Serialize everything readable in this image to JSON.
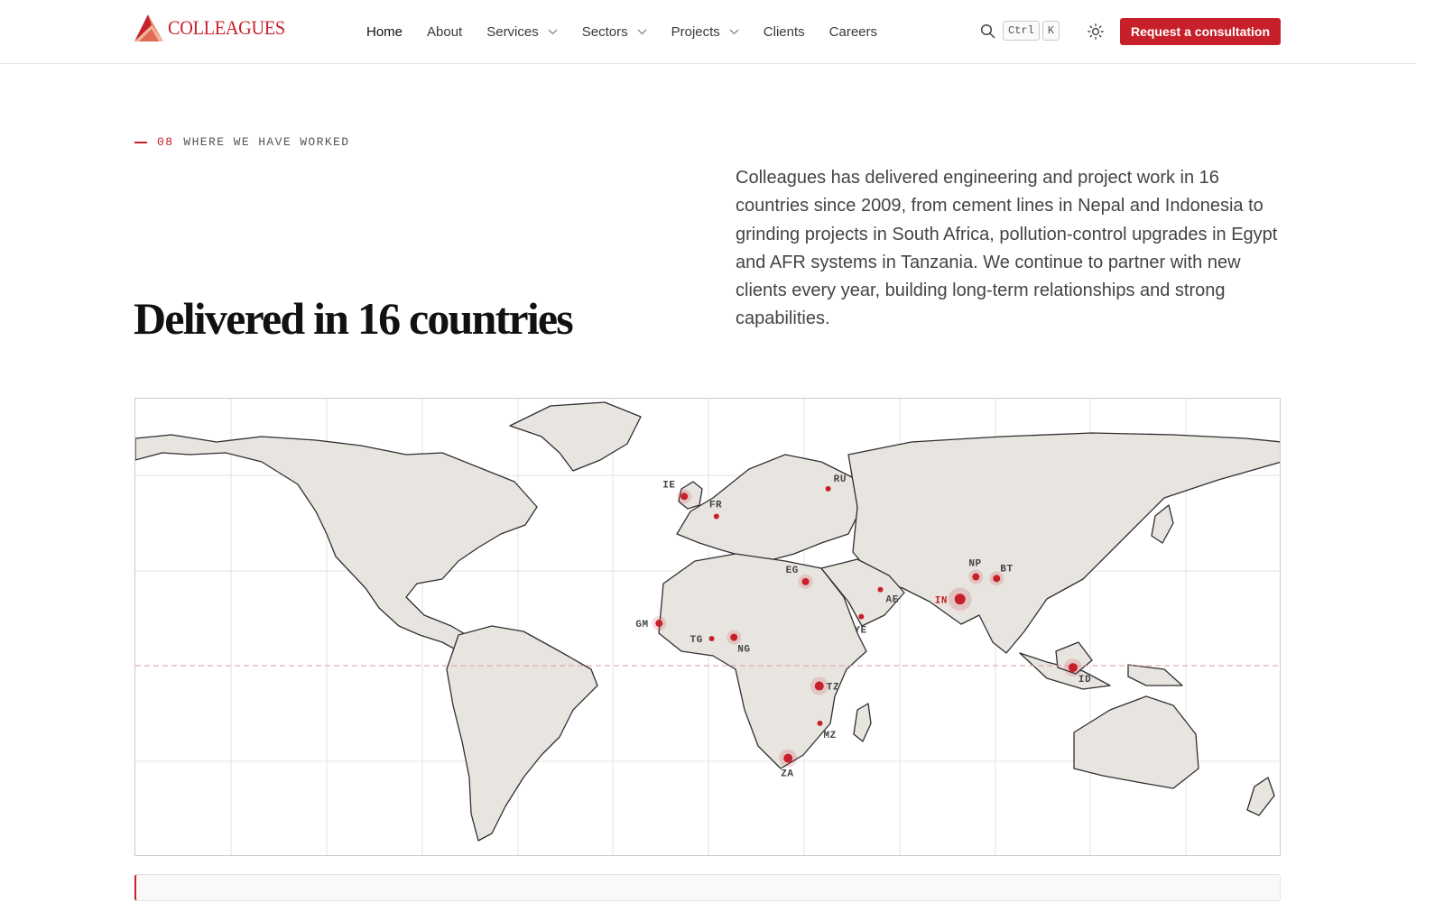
{
  "brand": {
    "name": "COLLEAGUES",
    "logo_icon": "triangular-peak-logo",
    "accent": "#c8202a"
  },
  "nav": {
    "items": [
      {
        "label": "Home",
        "active": true,
        "has_menu": false
      },
      {
        "label": "About",
        "active": false,
        "has_menu": false
      },
      {
        "label": "Services",
        "active": false,
        "has_menu": true
      },
      {
        "label": "Sectors",
        "active": false,
        "has_menu": true
      },
      {
        "label": "Projects",
        "active": false,
        "has_menu": true
      },
      {
        "label": "Clients",
        "active": false,
        "has_menu": false
      },
      {
        "label": "Careers",
        "active": false,
        "has_menu": false
      }
    ]
  },
  "toolbar": {
    "search_icon": "search-icon",
    "shortcut_keys": [
      "Ctrl",
      "K"
    ],
    "theme_icon": "sun-icon",
    "cta_label": "Request a consultation"
  },
  "section": {
    "number": "08",
    "eyebrow": "WHERE WE HAVE WORKED",
    "headline": "Delivered in 16 countries",
    "lede": "Colleagues has delivered engineering and project work in 16 countries since 2009, from cement lines in Nepal and Indonesia to grinding projects in South Africa, pollution-control upgrades in Egypt and AFR systems in Tanzania. We continue to partner with new clients every year, building long-term relationships and strong capabilities."
  },
  "map": {
    "projection": "equirectangular",
    "equator_line": "dashed",
    "marker_color": "#c8202a",
    "countries": [
      {
        "code": "IE",
        "lat": 53.3,
        "lon": -7.6,
        "size": "md"
      },
      {
        "code": "FR",
        "lat": 47.0,
        "lon": 2.5,
        "size": "sm"
      },
      {
        "code": "RU",
        "lat": 55.7,
        "lon": 37.6,
        "size": "sm"
      },
      {
        "code": "EG",
        "lat": 26.5,
        "lon": 30.5,
        "size": "md"
      },
      {
        "code": "AE",
        "lat": 24.0,
        "lon": 54.0,
        "size": "sm"
      },
      {
        "code": "YE",
        "lat": 15.5,
        "lon": 48.0,
        "size": "sm"
      },
      {
        "code": "IN",
        "lat": 21.0,
        "lon": 79.0,
        "size": "xl",
        "highlight": true
      },
      {
        "code": "NP",
        "lat": 28.0,
        "lon": 84.0,
        "size": "md"
      },
      {
        "code": "BT",
        "lat": 27.5,
        "lon": 90.5,
        "size": "md"
      },
      {
        "code": "GM",
        "lat": 13.4,
        "lon": -15.5,
        "size": "md"
      },
      {
        "code": "TG",
        "lat": 8.6,
        "lon": 1.0,
        "size": "sm"
      },
      {
        "code": "NG",
        "lat": 9.0,
        "lon": 8.0,
        "size": "md"
      },
      {
        "code": "TZ",
        "lat": -6.3,
        "lon": 34.8,
        "size": "lg"
      },
      {
        "code": "MZ",
        "lat": -18.0,
        "lon": 35.0,
        "size": "sm"
      },
      {
        "code": "ZA",
        "lat": -29.0,
        "lon": 25.0,
        "size": "lg"
      },
      {
        "code": "ID",
        "lat": -0.5,
        "lon": 114.5,
        "size": "lg"
      }
    ]
  }
}
